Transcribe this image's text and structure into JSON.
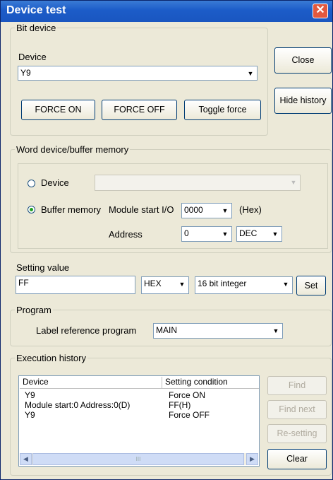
{
  "window": {
    "title": "Device test",
    "close_glyph": "✕"
  },
  "bit_device": {
    "legend": "Bit device",
    "device_label": "Device",
    "device_value": "Y9",
    "force_on": "FORCE ON",
    "force_off": "FORCE OFF",
    "toggle_force": "Toggle force"
  },
  "side": {
    "close": "Close",
    "hide_history": "Hide history"
  },
  "word_device": {
    "legend": "Word device/buffer memory",
    "device_radio": "Device",
    "device_value": "",
    "buffer_radio": "Buffer memory",
    "module_start_label": "Module start I/O",
    "module_start_value": "0000",
    "hex_unit": "(Hex)",
    "address_label": "Address",
    "address_value": "0",
    "address_format": "DEC",
    "selected": "buffer"
  },
  "setting": {
    "label": "Setting value",
    "value": "FF",
    "format": "HEX",
    "type": "16 bit integer",
    "set": "Set"
  },
  "program": {
    "legend": "Program",
    "label": "Label reference program",
    "value": "MAIN"
  },
  "history": {
    "legend": "Execution history",
    "columns": [
      "Device",
      "Setting condition"
    ],
    "rows": [
      [
        "Y9",
        "Force ON"
      ],
      [
        "Module start:0 Address:0(D)",
        "FF(H)"
      ],
      [
        "Y9",
        "Force OFF"
      ]
    ],
    "find": "Find",
    "find_next": "Find next",
    "resetting": "Re-setting",
    "clear": "Clear"
  }
}
